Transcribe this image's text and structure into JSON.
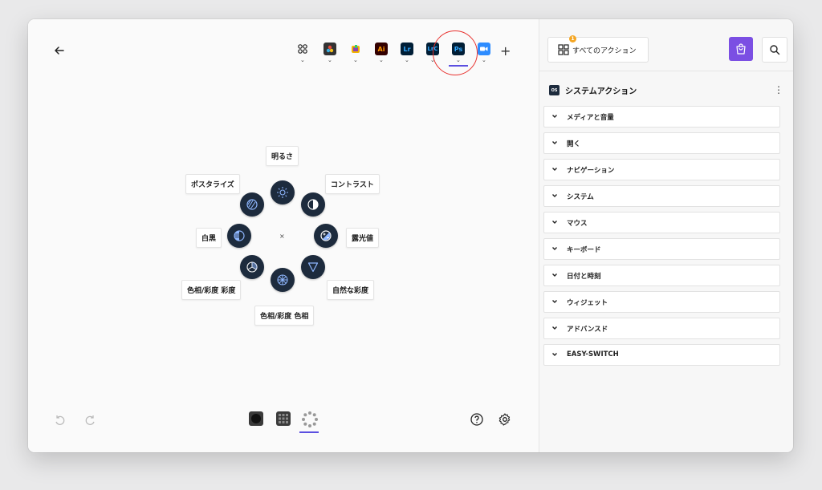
{
  "colors": {
    "accent": "#5b4fe0",
    "store": "#7b4fe3",
    "ring": "#1d2b3d",
    "ring_icon": "#8fb7ff",
    "highlight": "#e8322f"
  },
  "app_tabs": [
    {
      "name": "all-apps",
      "icon": "grid-icon",
      "label": ""
    },
    {
      "name": "davinci",
      "icon": "davinci-icon",
      "label": ""
    },
    {
      "name": "final-cut",
      "icon": "finalcut-icon",
      "label": ""
    },
    {
      "name": "illustrator",
      "icon": "ai-icon",
      "label": "Ai"
    },
    {
      "name": "lightroom",
      "icon": "lr-icon",
      "label": "Lr"
    },
    {
      "name": "lightroom-classic",
      "icon": "lrc-icon",
      "label": "LrC"
    },
    {
      "name": "photoshop",
      "icon": "ps-icon",
      "label": "Ps",
      "selected": true
    },
    {
      "name": "zoom",
      "icon": "zoom-icon",
      "label": ""
    }
  ],
  "radial": {
    "labels": {
      "brightness": "明るさ",
      "contrast": "コントラスト",
      "exposure": "露光値",
      "vibrance": "自然な彩度",
      "hue": "色相/彩度 色相",
      "saturation": "色相/彩度 彩度",
      "bw": "白黒",
      "posterize": "ポスタライズ"
    },
    "center": "×"
  },
  "right": {
    "all_actions": "すべてのアクション",
    "badge": "1",
    "section_badge": "OS",
    "section_title": "システムアクション",
    "categories": [
      "メディアと音量",
      "開く",
      "ナビゲーション",
      "システム",
      "マウス",
      "キーボード",
      "日付と時刻",
      "ウィジェット",
      "アドバンスド",
      "EASY-SWITCH"
    ]
  }
}
